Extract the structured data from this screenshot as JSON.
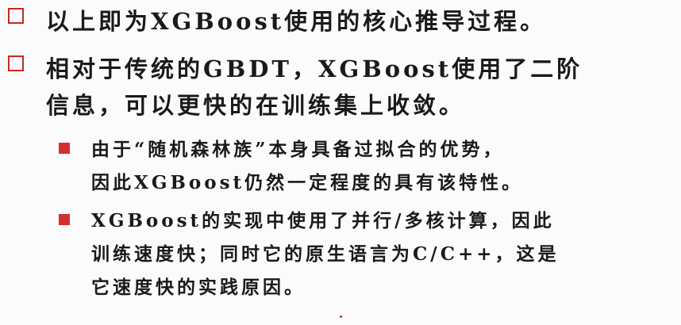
{
  "bullets": [
    {
      "lines": [
        "以上即为XGBoost使用的核心推导过程。"
      ]
    },
    {
      "lines": [
        "相对于传统的GBDT，XGBoost使用了二阶",
        "信息，可以更快的在训练集上收敛。"
      ]
    }
  ],
  "sub_bullets": [
    {
      "lines": [
        "由于“随机森林族”本身具备过拟合的优势，",
        "因此XGBoost仍然一定程度的具有该特性。"
      ]
    },
    {
      "lines": [
        "XGBoost的实现中使用了并行/多核计算，因此",
        "训练速度快；同时它的原生语言为C/C++，这是",
        "它速度快的实践原因。"
      ]
    }
  ],
  "colors": {
    "bullet_accent": "#c62828",
    "text": "#1a1a1a",
    "background": "#fbfbfb"
  },
  "icons": {
    "level1_bullet": "hollow-square-icon",
    "level2_bullet": "filled-square-icon"
  }
}
